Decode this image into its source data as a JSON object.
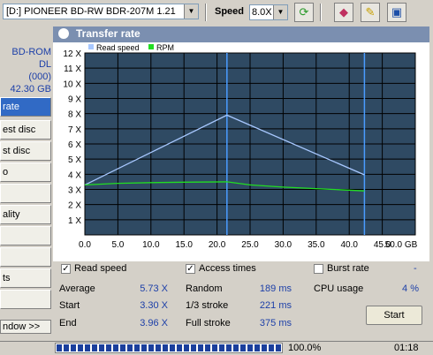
{
  "toolbar": {
    "drive": "[D:]  PIONEER BD-RW   BDR-207M 1.21",
    "speed_label": "Speed",
    "speed_value": "8.0X",
    "buttons": {
      "refresh": "refresh-icon",
      "erase": "eraser-icon",
      "options": "options-icon",
      "save": "save-icon"
    }
  },
  "disc_info": {
    "type": "BD-ROM DL",
    "code": "(000)",
    "capacity": "42.30 GB",
    "kind": "data"
  },
  "nav": {
    "items": [
      "rate",
      "est disc",
      "st disc",
      "o",
      "",
      "ality",
      "",
      "",
      "ts",
      ""
    ],
    "active_index": 0
  },
  "window_link": "ndow >>",
  "panel_title": "Transfer rate",
  "colors": {
    "read_speed": "#a8c8ff",
    "rpm": "#22dd22",
    "plot_bg": "#2f4a63",
    "grid": "#000000",
    "marker": "#4a9cff"
  },
  "chart_data": {
    "type": "line",
    "legend": [
      "Read speed",
      "RPM"
    ],
    "x_ticks": [
      "0.0",
      "5.0",
      "10.0",
      "15.0",
      "20.0",
      "25.0",
      "30.0",
      "35.0",
      "40.0",
      "45.0",
      "50.0 GB"
    ],
    "y_ticks": [
      "1 X",
      "2 X",
      "3 X",
      "4 X",
      "5 X",
      "6 X",
      "7 X",
      "8 X",
      "9 X",
      "10 X",
      "11 X",
      "12 X"
    ],
    "xlim": [
      0,
      50
    ],
    "ylim": [
      0,
      12
    ],
    "series": [
      {
        "name": "Read speed",
        "x": [
          0,
          21.5,
          42.3
        ],
        "y": [
          3.3,
          7.9,
          3.96
        ]
      },
      {
        "name": "RPM",
        "x": [
          0,
          5,
          10,
          15,
          21.5,
          25,
          30,
          35,
          42.3
        ],
        "y": [
          3.3,
          3.4,
          3.45,
          3.48,
          3.5,
          3.3,
          3.15,
          3.05,
          2.9
        ]
      }
    ],
    "vlines": [
      21.5,
      42.3
    ],
    "grid": true,
    "legend_position": "top-left"
  },
  "stats": {
    "read_speed_cb": "Read speed",
    "access_times_cb": "Access times",
    "burst_rate_cb": "Burst rate",
    "burst_dash": "-",
    "average_label": "Average",
    "average_val": "5.73 X",
    "start_label": "Start",
    "start_val": "3.30 X",
    "end_label": "End",
    "end_val": "3.96 X",
    "random_label": "Random",
    "random_val": "189 ms",
    "third_label": "1/3 stroke",
    "third_val": "221 ms",
    "full_label": "Full stroke",
    "full_val": "375 ms",
    "cpu_label": "CPU usage",
    "cpu_val": "4 %",
    "start_button": "Start"
  },
  "status": {
    "progress_pct": "100.0%",
    "progress_fraction": 1.0,
    "elapsed": "01:18"
  }
}
